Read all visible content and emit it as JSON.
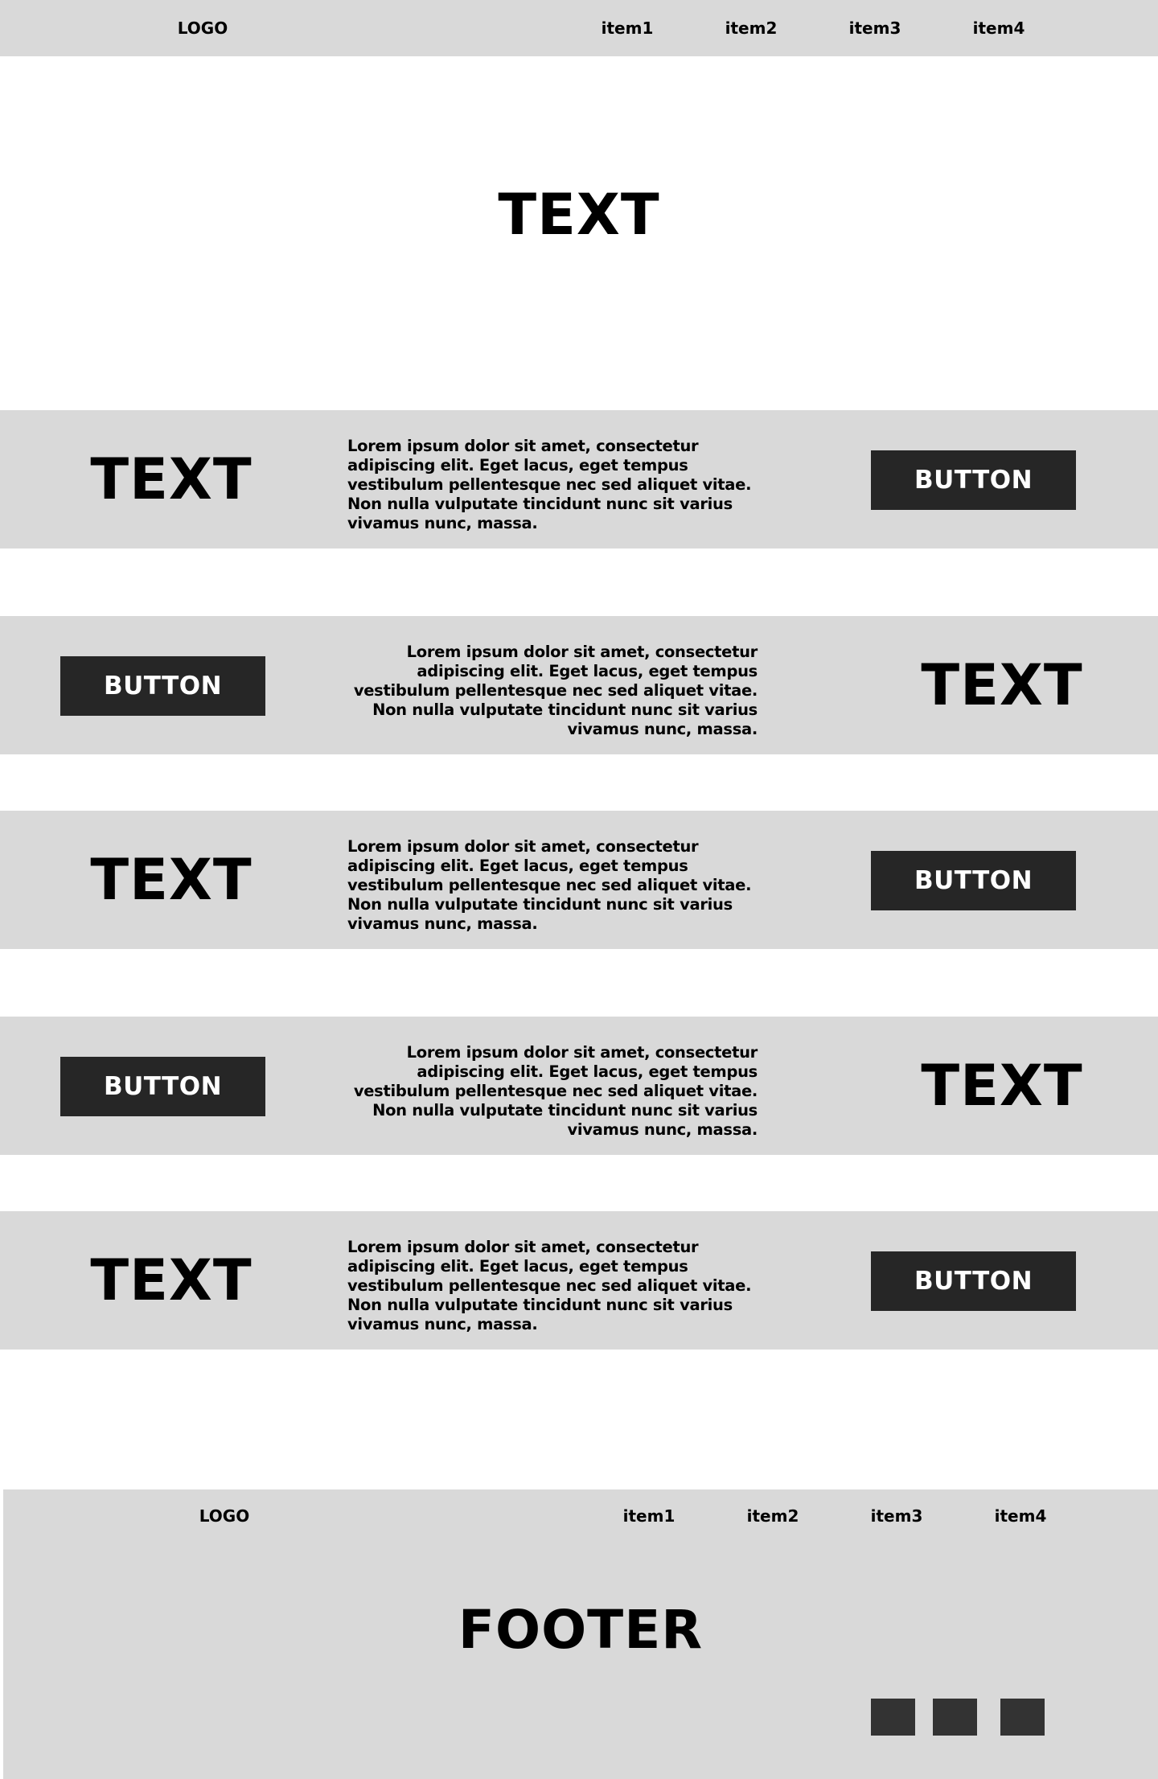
{
  "header": {
    "logo": "LOGO",
    "nav": [
      "item1",
      "item2",
      "item3",
      "item4"
    ]
  },
  "hero": {
    "title": "TEXT"
  },
  "sections": [
    {
      "title": "TEXT",
      "text": "Lorem ipsum dolor sit amet, consectetur adipiscing elit. Eget lacus, eget tempus vestibulum pellentesque nec sed aliquet vitae. Non nulla vulputate tincidunt nunc sit varius vivamus nunc, massa.",
      "button": "BUTTON"
    },
    {
      "title": "TEXT",
      "text": "Lorem ipsum dolor sit amet, consectetur adipiscing elit. Eget lacus, eget tempus vestibulum pellentesque nec sed aliquet vitae. Non nulla vulputate tincidunt nunc sit varius vivamus nunc, massa.",
      "button": "BUTTON"
    },
    {
      "title": "TEXT",
      "text": "Lorem ipsum dolor sit amet, consectetur adipiscing elit. Eget lacus, eget tempus vestibulum pellentesque nec sed aliquet vitae. Non nulla vulputate tincidunt nunc sit varius vivamus nunc, massa.",
      "button": "BUTTON"
    },
    {
      "title": "TEXT",
      "text": "Lorem ipsum dolor sit amet, consectetur adipiscing elit. Eget lacus, eget tempus vestibulum pellentesque nec sed aliquet vitae. Non nulla vulputate tincidunt nunc sit varius vivamus nunc, massa.",
      "button": "BUTTON"
    },
    {
      "title": "TEXT",
      "text": "Lorem ipsum dolor sit amet, consectetur adipiscing elit. Eget lacus, eget tempus vestibulum pellentesque nec sed aliquet vitae. Non nulla vulputate tincidunt nunc sit varius vivamus nunc, massa.",
      "button": "BUTTON"
    }
  ],
  "footer": {
    "logo": "LOGO",
    "nav": [
      "item1",
      "item2",
      "item3",
      "item4"
    ],
    "title": "FOOTER",
    "social_icons": [
      "social-icon-1",
      "social-icon-2",
      "social-icon-3"
    ]
  },
  "colors": {
    "band_background": "#d9d9d9",
    "button_background": "#262626",
    "social_icon": "#333333"
  }
}
